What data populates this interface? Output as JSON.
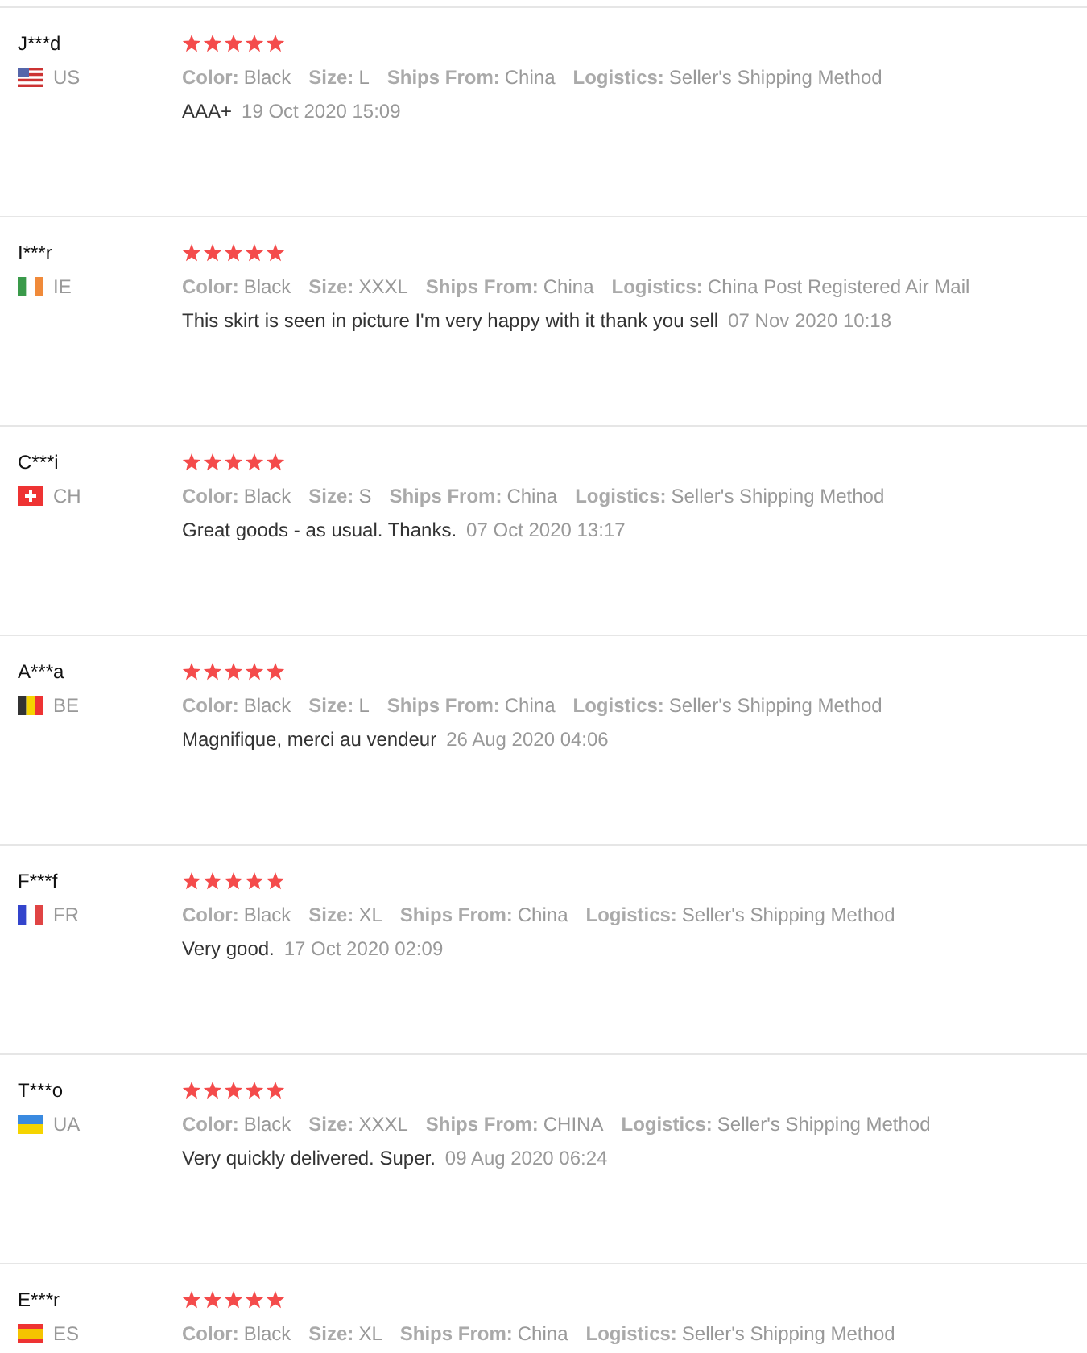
{
  "reviews": [
    {
      "name": "J***d",
      "flag": {
        "kind": "us"
      },
      "country": "US",
      "stars": 5,
      "details": [
        {
          "label": "Color:",
          "value": "Black"
        },
        {
          "label": "Size:",
          "value": "L"
        },
        {
          "label": "Ships From:",
          "value": "China"
        },
        {
          "label": "Logistics:",
          "value": "Seller's Shipping Method"
        }
      ],
      "comment": "AAA+",
      "date": "19 Oct 2020 15:09"
    },
    {
      "name": "I***r",
      "flag": {
        "kind": "ie"
      },
      "country": "IE",
      "stars": 5,
      "details": [
        {
          "label": "Color:",
          "value": "Black"
        },
        {
          "label": "Size:",
          "value": "XXXL"
        },
        {
          "label": "Ships From:",
          "value": "China"
        },
        {
          "label": "Logistics:",
          "value": "China Post Registered Air Mail"
        }
      ],
      "comment": "This skirt is seen in picture I'm very happy with it thank you sell",
      "date": "07 Nov 2020 10:18"
    },
    {
      "name": "C***i",
      "flag": {
        "kind": "ch"
      },
      "country": "CH",
      "stars": 5,
      "details": [
        {
          "label": "Color:",
          "value": "Black"
        },
        {
          "label": "Size:",
          "value": "S"
        },
        {
          "label": "Ships From:",
          "value": "China"
        },
        {
          "label": "Logistics:",
          "value": "Seller's Shipping Method"
        }
      ],
      "comment": "Great goods - as usual. Thanks.",
      "date": "07 Oct 2020 13:17"
    },
    {
      "name": "A***a",
      "flag": {
        "kind": "be"
      },
      "country": "BE",
      "stars": 5,
      "details": [
        {
          "label": "Color:",
          "value": "Black"
        },
        {
          "label": "Size:",
          "value": "L"
        },
        {
          "label": "Ships From:",
          "value": "China"
        },
        {
          "label": "Logistics:",
          "value": "Seller's Shipping Method"
        }
      ],
      "comment": "Magnifique, merci au vendeur",
      "date": "26 Aug 2020 04:06"
    },
    {
      "name": "F***f",
      "flag": {
        "kind": "fr"
      },
      "country": "FR",
      "stars": 5,
      "details": [
        {
          "label": "Color:",
          "value": "Black"
        },
        {
          "label": "Size:",
          "value": "XL"
        },
        {
          "label": "Ships From:",
          "value": "China"
        },
        {
          "label": "Logistics:",
          "value": "Seller's Shipping Method"
        }
      ],
      "comment": "Very good.",
      "date": "17 Oct 2020 02:09"
    },
    {
      "name": "T***o",
      "flag": {
        "kind": "ua"
      },
      "country": "UA",
      "stars": 5,
      "details": [
        {
          "label": "Color:",
          "value": "Black"
        },
        {
          "label": "Size:",
          "value": "XXXL"
        },
        {
          "label": "Ships From:",
          "value": "CHINA"
        },
        {
          "label": "Logistics:",
          "value": "Seller's Shipping Method"
        }
      ],
      "comment": "Very quickly delivered. Super.",
      "date": "09 Aug 2020 06:24"
    },
    {
      "name": "E***r",
      "flag": {
        "kind": "es"
      },
      "country": "ES",
      "stars": 5,
      "details": [
        {
          "label": "Color:",
          "value": "Black"
        },
        {
          "label": "Size:",
          "value": "XL"
        },
        {
          "label": "Ships From:",
          "value": "China"
        },
        {
          "label": "Logistics:",
          "value": "Seller's Shipping Method"
        }
      ]
    }
  ]
}
